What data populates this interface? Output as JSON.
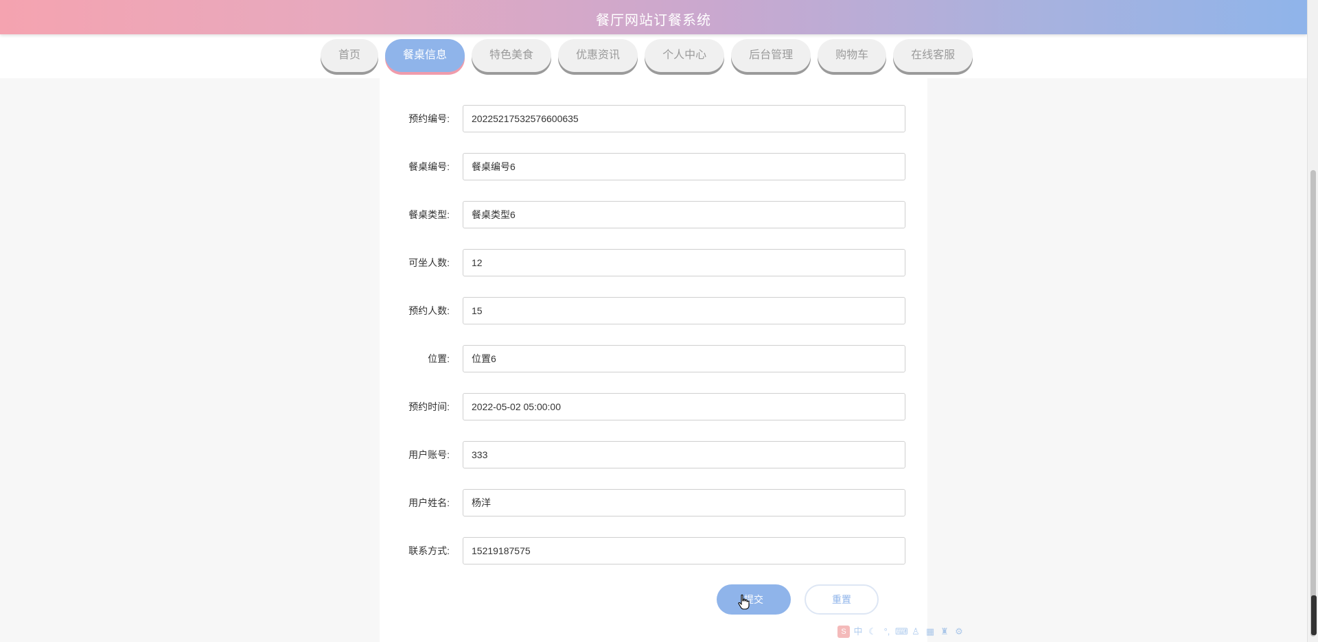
{
  "header": {
    "title": "餐厅网站订餐系统"
  },
  "nav": {
    "items": [
      {
        "label": "首页",
        "active": false
      },
      {
        "label": "餐桌信息",
        "active": true
      },
      {
        "label": "特色美食",
        "active": false
      },
      {
        "label": "优惠资讯",
        "active": false
      },
      {
        "label": "个人中心",
        "active": false
      },
      {
        "label": "后台管理",
        "active": false
      },
      {
        "label": "购物车",
        "active": false
      },
      {
        "label": "在线客服",
        "active": false
      }
    ]
  },
  "form": {
    "fields": [
      {
        "label": "预约编号:",
        "value": "20225217532576600635"
      },
      {
        "label": "餐桌编号:",
        "value": "餐桌编号6"
      },
      {
        "label": "餐桌类型:",
        "value": "餐桌类型6"
      },
      {
        "label": "可坐人数:",
        "value": "12"
      },
      {
        "label": "预约人数:",
        "value": "15"
      },
      {
        "label": "位置:",
        "value": "位置6"
      },
      {
        "label": "预约时间:",
        "value": "2022-05-02 05:00:00"
      },
      {
        "label": "用户账号:",
        "value": "333"
      },
      {
        "label": "用户姓名:",
        "value": "杨洋"
      },
      {
        "label": "联系方式:",
        "value": "15219187575"
      }
    ],
    "submit_label": "提交",
    "reset_label": "重置"
  },
  "ime_toolbar": {
    "logo": "S",
    "mode": "中",
    "icons": [
      "moon-icon",
      "punctuation-icon",
      "keyboard-icon",
      "user-icon",
      "grid-icon",
      "shirt-icon",
      "gear-icon"
    ]
  },
  "colors": {
    "accent": "#8fb4ea",
    "accent_pink": "#f09bab",
    "header_gradient_start": "#f5a3b0",
    "header_gradient_end": "#8fb4ea"
  }
}
